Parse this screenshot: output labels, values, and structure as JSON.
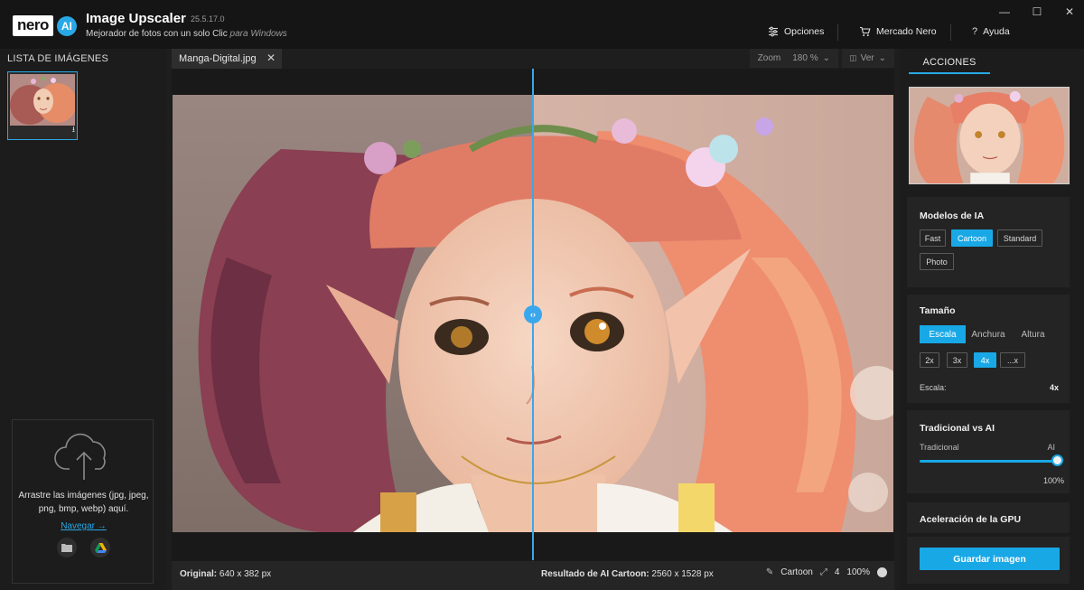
{
  "app": {
    "logo_text": "nero",
    "logo_badge": "AI",
    "title": "Image Upscaler",
    "version": "25.5.17.0",
    "subtitle": "Mejorador de fotos con un solo Clic",
    "subtitle_platform": "para Windows"
  },
  "topmenu": {
    "options": "Opciones",
    "market": "Mercado Nero",
    "help": "Ayuda"
  },
  "window_controls": {
    "minimize": "—",
    "maximize": "☐",
    "close": "✕"
  },
  "left_panel": {
    "title": "LISTA DE IMÁGENES",
    "dropzone_text": "Arrastre las imágenes (jpg, jpeg, png, bmp, webp) aquí.",
    "browse_link": "Navegar →"
  },
  "center": {
    "tab_name": "Manga-Digital.jpg",
    "zoom_label": "Zoom",
    "zoom_value": "180 %",
    "view_label": "Ver",
    "status": {
      "original_label": "Original:",
      "original_value": "640 x 382 px",
      "result_label": "Resultado de AI Cartoon:",
      "result_value": "2560 x 1528 px",
      "model": "Cartoon",
      "scale": "4",
      "quality": "100%"
    }
  },
  "right_panel": {
    "tab_label": "ACCIONES",
    "models": {
      "title": "Modelos de IA",
      "options": [
        "Fast",
        "Cartoon",
        "Standard",
        "Photo"
      ],
      "selected": "Cartoon"
    },
    "size": {
      "title": "Tamaño",
      "modes": [
        "Escala",
        "Anchura",
        "Altura"
      ],
      "selected_mode": "Escala",
      "factors": [
        "2x",
        "3x",
        "4x",
        "...x"
      ],
      "selected_factor": "4x",
      "scale_label": "Escala:",
      "scale_value": "4x"
    },
    "traditional_vs_ai": {
      "title": "Tradicional vs AI",
      "left_label": "Tradicional",
      "right_label": "AI",
      "value_text": "100%",
      "value": 1.0
    },
    "gpu": {
      "title": "Aceleración de la GPU"
    },
    "save_button": "Guardar imagen"
  },
  "colors": {
    "accent": "#19a8e6",
    "background": "#1e1e1e",
    "titlebar": "#151515"
  }
}
